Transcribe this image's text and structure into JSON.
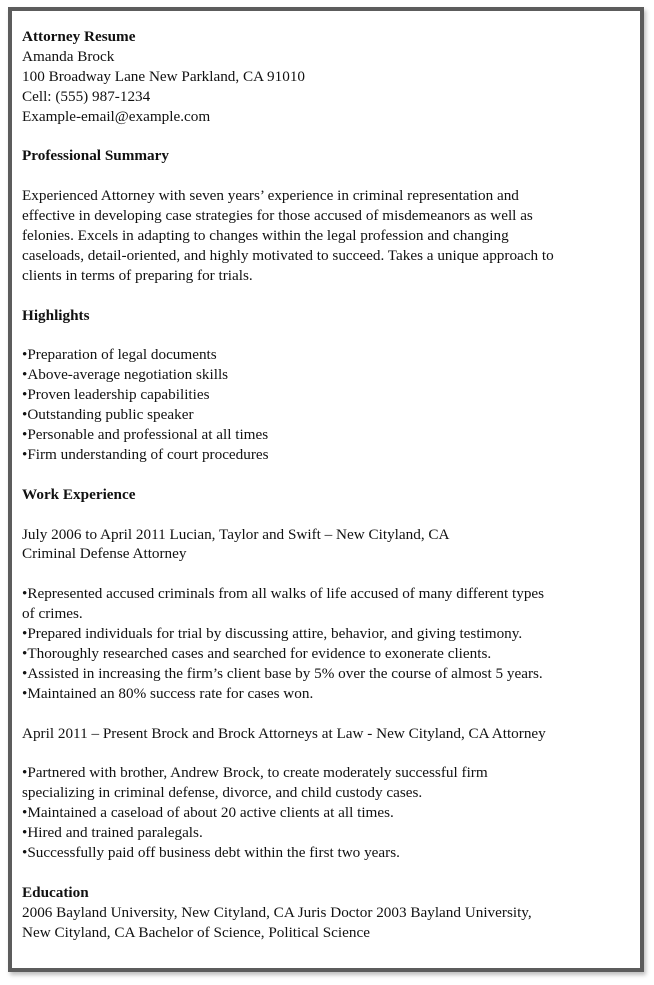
{
  "header": {
    "title": "Attorney Resume",
    "name": "Amanda Brock",
    "address": "100 Broadway Lane New Parkland, CA 91010",
    "phone": "Cell: (555) 987-1234",
    "email": "Example-email@example.com"
  },
  "summary": {
    "heading": "Professional Summary",
    "lines": [
      "Experienced Attorney with seven years’ experience in criminal representation and",
      "effective in developing case strategies for those accused of misdemeanors as well as",
      "felonies. Excels in adapting to changes within the legal profession and changing",
      "caseloads, detail-oriented, and highly motivated to succeed. Takes a unique approach to",
      "clients in terms of preparing for trials."
    ]
  },
  "highlights": {
    "heading": "Highlights",
    "items": [
      "•Preparation of legal documents",
      "•Above-average negotiation skills",
      "•Proven leadership capabilities",
      "•Outstanding public speaker",
      "•Personable and professional at all times",
      "•Firm understanding of court procedures"
    ]
  },
  "work": {
    "heading": "Work Experience",
    "jobs": [
      {
        "header_lines": [
          "July 2006 to April 2011 Lucian, Taylor and Swift – New Cityland, CA",
          "Criminal Defense Attorney"
        ],
        "bullet_lines": [
          "•Represented accused criminals from all walks of life accused of many different types",
          "of crimes.",
          "•Prepared individuals for trial by discussing attire, behavior, and giving testimony.",
          "•Thoroughly researched cases and searched for evidence to exonerate clients.",
          "•Assisted in increasing the firm’s client base by 5% over the course of almost 5 years.",
          "•Maintained an 80% success rate for cases won."
        ]
      },
      {
        "header_lines": [
          "April 2011 – Present Brock and Brock Attorneys at Law - New Cityland, CA Attorney"
        ],
        "bullet_lines": [
          "•Partnered with brother, Andrew Brock, to create moderately successful firm",
          "specializing in criminal defense, divorce, and child custody cases.",
          "•Maintained a caseload of about 20 active clients at all times.",
          "•Hired and trained paralegals.",
          "•Successfully paid off business debt within the first two years."
        ]
      }
    ]
  },
  "education": {
    "heading": "Education",
    "lines": [
      "2006 Bayland University, New Cityland, CA Juris Doctor 2003 Bayland University,",
      "New Cityland, CA Bachelor of Science, Political Science"
    ]
  }
}
